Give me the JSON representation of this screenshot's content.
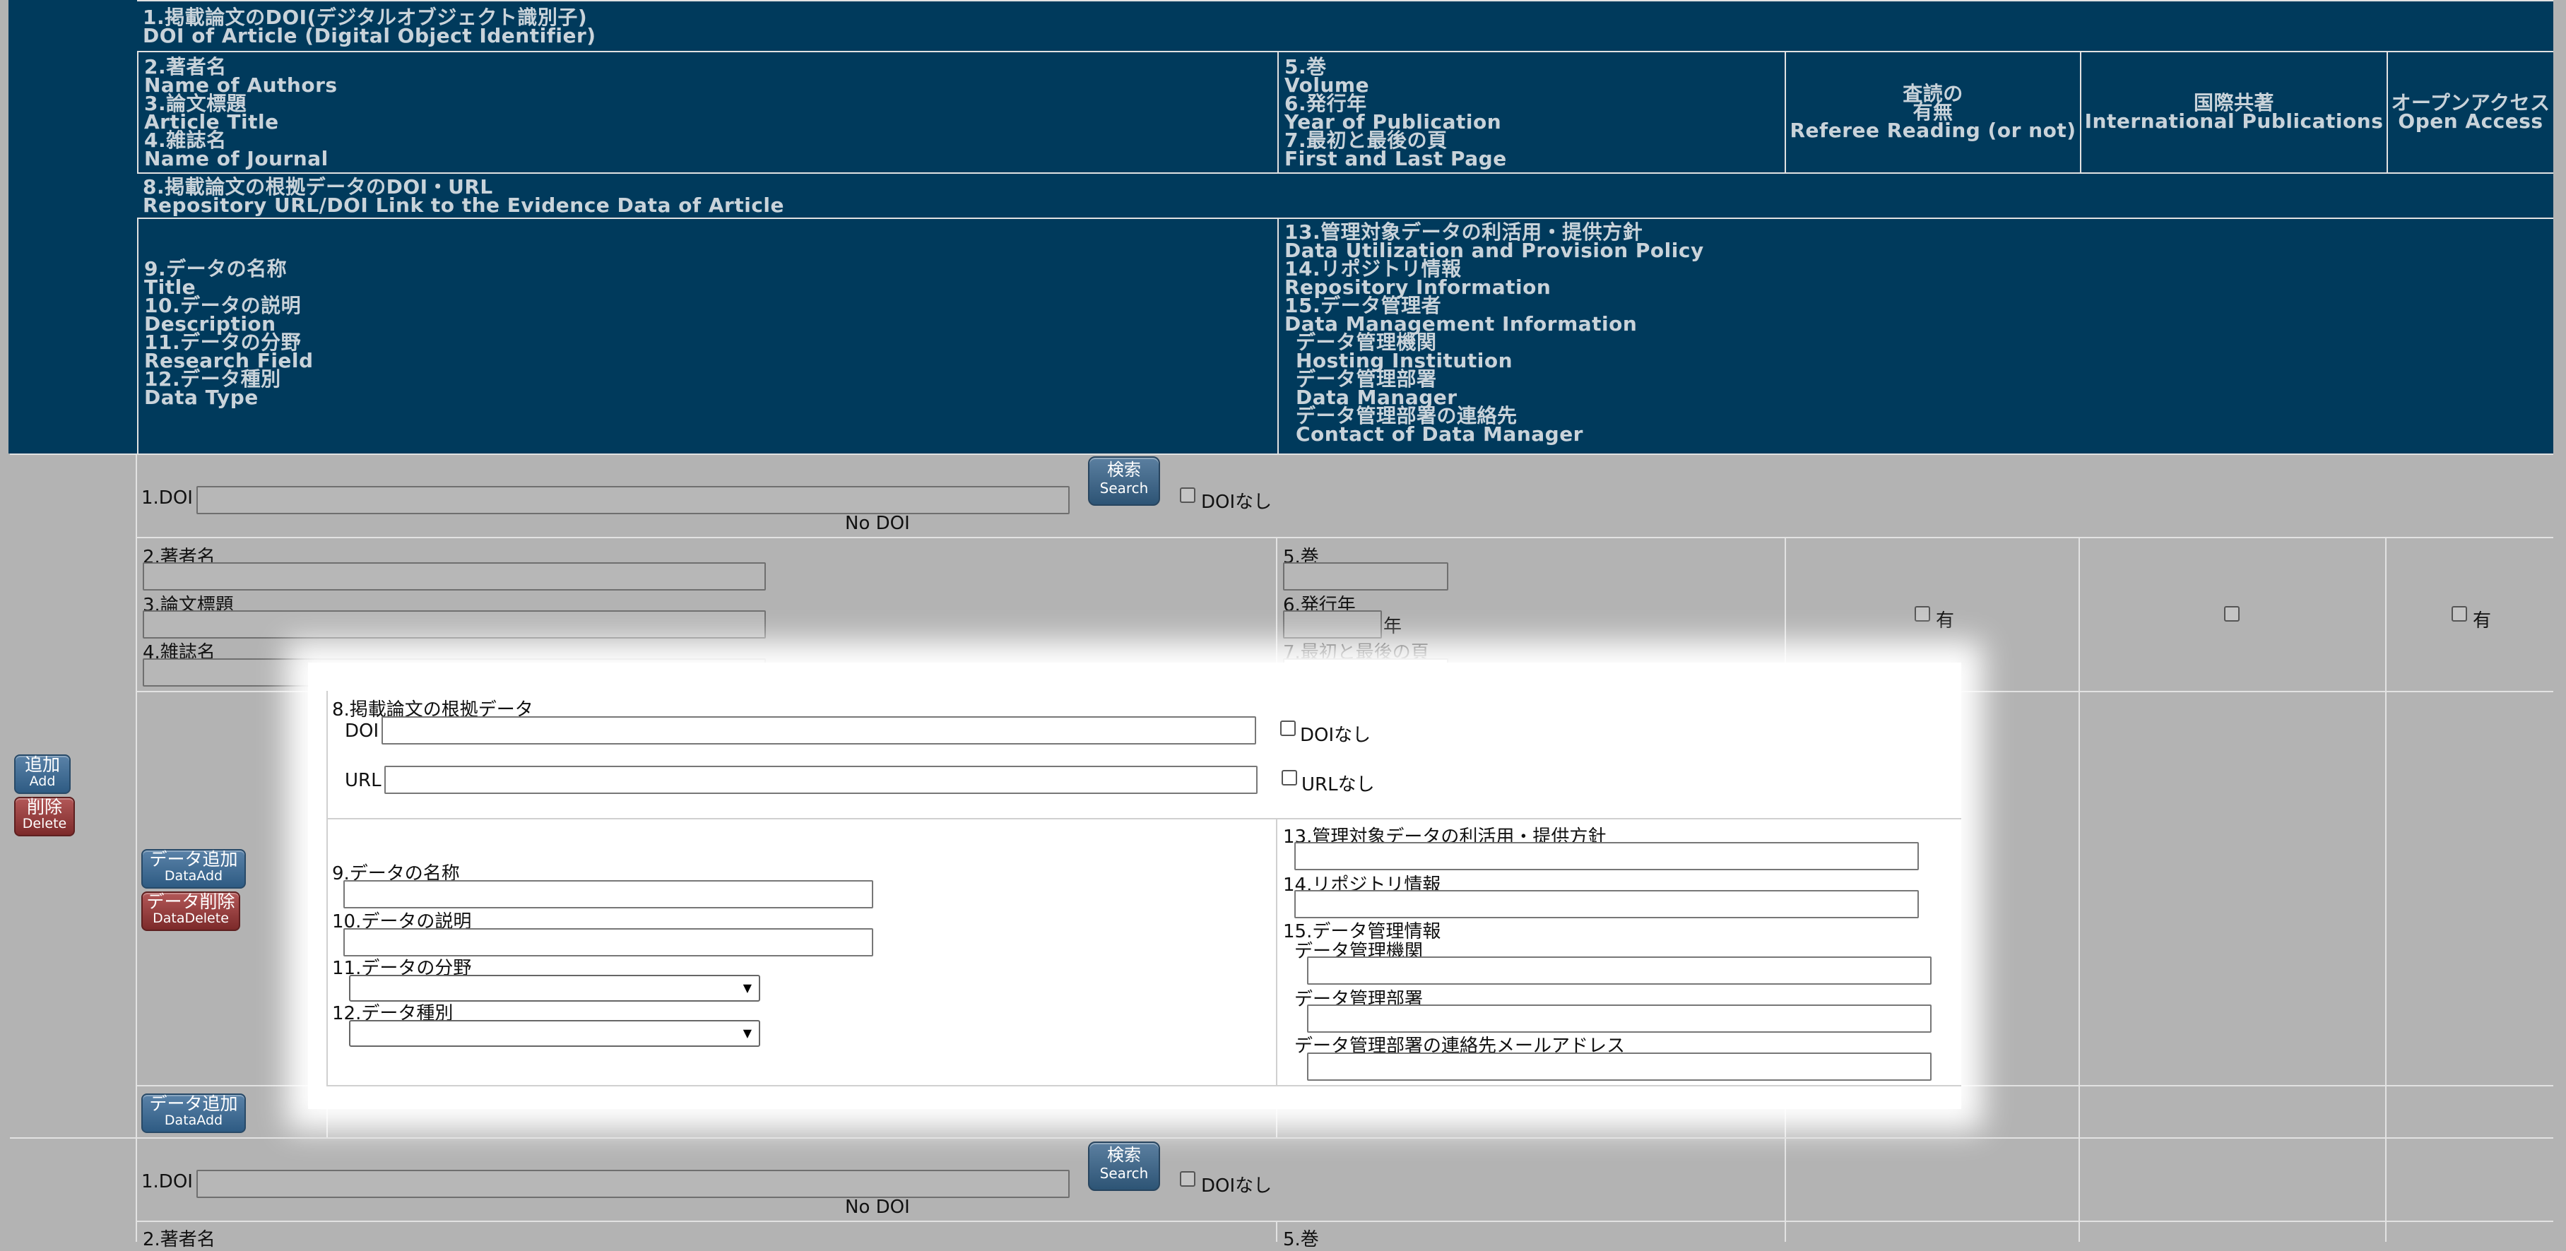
{
  "header": {
    "h1_ja": "1.掲載論文のDOI(デジタルオブジェクト識別子)",
    "h1_en": "DOI of Article (Digital Object Identifier)",
    "h_left": [
      "2.著者名",
      "Name of Authors",
      "3.論文標題",
      "Article Title",
      "4.雑誌名",
      "Name of Journal"
    ],
    "h_mid": [
      "5.巻",
      "Volume",
      "6.発行年",
      "Year of Publication",
      "7.最初と最後の頁",
      "First and Last Page"
    ],
    "referee": [
      "査読の",
      "有無",
      "Referee Reading (or not)"
    ],
    "intl": [
      "国際共著",
      "International Publications"
    ],
    "open": [
      "オープンアクセス",
      "Open Access"
    ],
    "h8_ja": "8.掲載論文の根拠データのDOI・URL",
    "h8_en": "Repository URL/DOI Link to the Evidence Data of Article",
    "h9_left": [
      "9.データの名称",
      "Title",
      "10.データの説明",
      "Description",
      "11.データの分野",
      "Research Field",
      "12.データ種別",
      "Data Type"
    ],
    "h13_right": [
      "13.管理対象データの利活用・提供方針",
      "Data Utilization and Provision Policy",
      "14.リポジトリ情報",
      "Repository Information",
      "15.データ管理者",
      "Data Management Information",
      "  データ管理機関",
      "  Hosting Institution",
      "  データ管理部署",
      "  Data Manager",
      "  データ管理部署の連絡先",
      "  Contact of Data Manager"
    ]
  },
  "record": {
    "doi_label": "1.DOI",
    "doi_value": "",
    "search_ja": "検索",
    "search_en": "Search",
    "no_doi_check": "DOIなし",
    "no_doi_text": "No DOI",
    "authors_label": "2.著者名",
    "title_label": "3.論文標題",
    "journal_label": "4.雑誌名",
    "volume_label": "5.巻",
    "year_label": "6.発行年",
    "year_suffix": "年",
    "pages_label": "7.最初と最後の頁",
    "referee_yes": "有",
    "open_yes": "有",
    "add_ja": "追加",
    "add_en": "Add",
    "del_ja": "削除",
    "del_en": "Delete",
    "dataadd_ja": "データ追加",
    "dataadd_en": "DataAdd",
    "datadel_ja": "データ削除",
    "datadel_en": "DataDelete"
  },
  "evidence": {
    "label8": "8.掲載論文の根拠データ",
    "doi_label": "DOI",
    "doi_none": "DOIなし",
    "url_label": "URL",
    "url_none": "URLなし",
    "label9": "9.データの名称",
    "label10": "10.データの説明",
    "label11": "11.データの分野",
    "label12": "12.データ種別",
    "label13": "13.管理対象データの利活用・提供方針",
    "label14": "14.リポジトリ情報",
    "label15": "15.データ管理情報",
    "label15a": "データ管理機関",
    "label15b": "データ管理部署",
    "label15c": "データ管理部署の連絡先メールアドレス",
    "field11_selected": "",
    "field12_selected": ""
  },
  "record2": {
    "doi_label": "1.DOI",
    "no_doi_check": "DOIなし",
    "no_doi_text": "No DOI",
    "authors_label": "2.著者名",
    "volume_label": "5.巻"
  },
  "colors": {
    "header_bg": "#003a5c",
    "body_bg": "#b3b3b3",
    "button_blue": "#2e5b83",
    "button_red": "#7c2a2a"
  }
}
